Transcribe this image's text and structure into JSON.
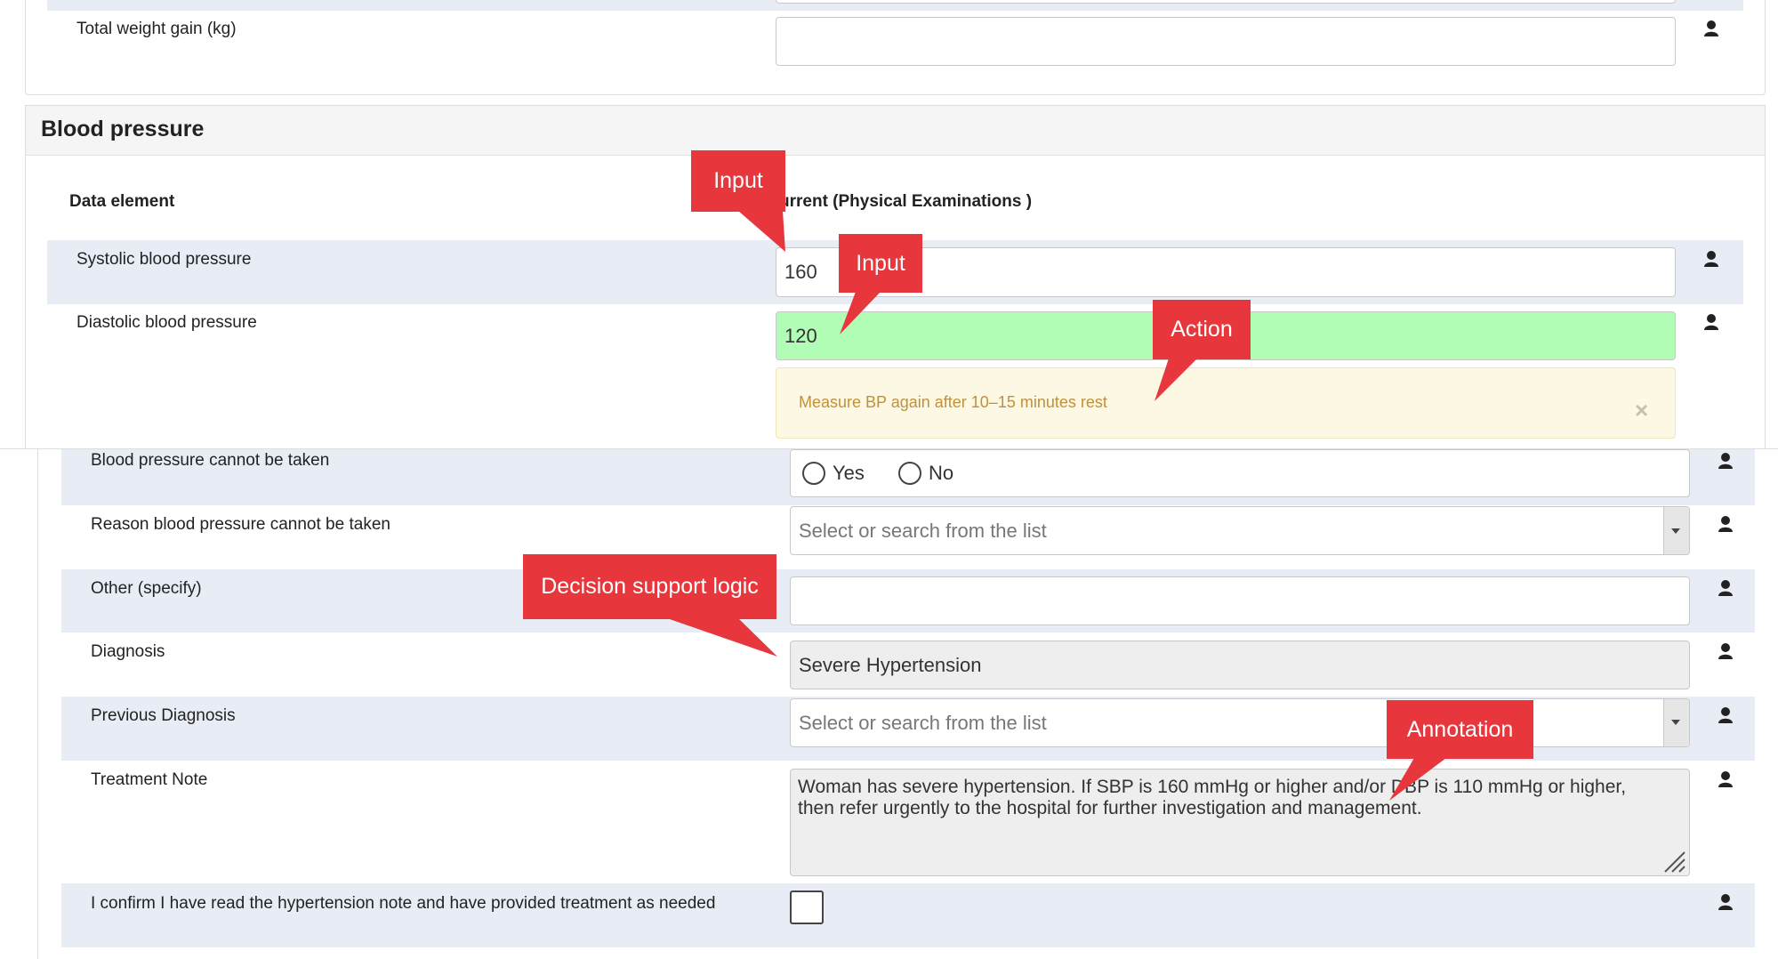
{
  "weight_row": {
    "label": "Total weight gain (kg)",
    "value": ""
  },
  "section": {
    "title": "Blood pressure"
  },
  "table_header": {
    "col1": "Data element",
    "col2": "urrent (Physical Examinations )"
  },
  "rows": {
    "systolic": {
      "label": "Systolic blood pressure",
      "value": "160"
    },
    "diastolic": {
      "label": "Diastolic blood pressure",
      "value": "120"
    },
    "alert": {
      "text": "Measure BP again after 10–15 minutes rest",
      "close": "×"
    },
    "cannot_take": {
      "label": "Blood pressure cannot be taken",
      "yes": "Yes",
      "no": "No"
    },
    "reason": {
      "label": "Reason blood pressure cannot be taken",
      "placeholder": "Select or search from the list"
    },
    "other": {
      "label": "Other (specify)",
      "value": ""
    },
    "diagnosis": {
      "label": "Diagnosis",
      "value": "Severe Hypertension"
    },
    "previous": {
      "label": "Previous Diagnosis",
      "placeholder": "Select or search from the list"
    },
    "treatment": {
      "label": "Treatment Note",
      "value": "Woman has severe hypertension. If SBP is 160 mmHg or higher and/or DBP is 110 mmHg or higher, then refer urgently to the hospital for further investigation and management."
    },
    "confirm": {
      "label": "I confirm I have read the hypertension note and have provided treatment as needed"
    }
  },
  "callouts": {
    "input1": "Input",
    "input2": "Input",
    "action": "Action",
    "decision": "Decision support logic",
    "annotation": "Annotation"
  },
  "icons": {
    "user": "user-icon",
    "dropdown": "caret-down-icon",
    "close": "close-icon"
  },
  "colors": {
    "callout": "#e8363d",
    "highlight": "#b2fdb5",
    "alert_bg": "#fdf8e3",
    "alert_text": "#c0913a",
    "row_bg": "#e8edf5"
  }
}
